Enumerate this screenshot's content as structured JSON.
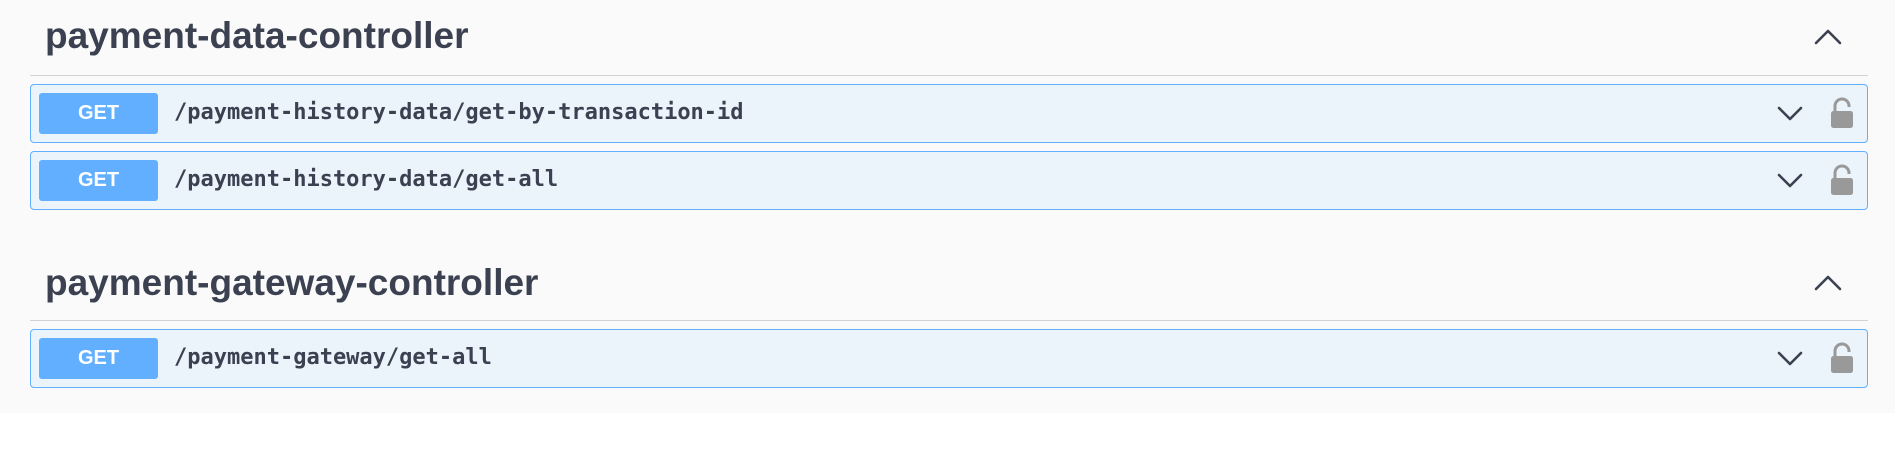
{
  "sections": [
    {
      "title": "payment-data-controller",
      "collapse_icon": "chevron-up-icon",
      "operations": [
        {
          "method": "GET",
          "path": "/payment-history-data/get-by-transaction-id",
          "expand_icon": "chevron-down-icon",
          "lock_icon": "unlocked-padlock-icon"
        },
        {
          "method": "GET",
          "path": "/payment-history-data/get-all",
          "expand_icon": "chevron-down-icon",
          "lock_icon": "unlocked-padlock-icon"
        }
      ]
    },
    {
      "title": "payment-gateway-controller",
      "collapse_icon": "chevron-up-icon",
      "operations": [
        {
          "method": "GET",
          "path": "/payment-gateway/get-all",
          "expand_icon": "chevron-down-icon",
          "lock_icon": "unlocked-padlock-icon"
        }
      ]
    }
  ],
  "colors": {
    "get_accent": "#61affe",
    "get_background": "#ebf3fb",
    "text": "#3b4151",
    "panel_background": "#fafafa",
    "icon_gray": "#999999"
  }
}
